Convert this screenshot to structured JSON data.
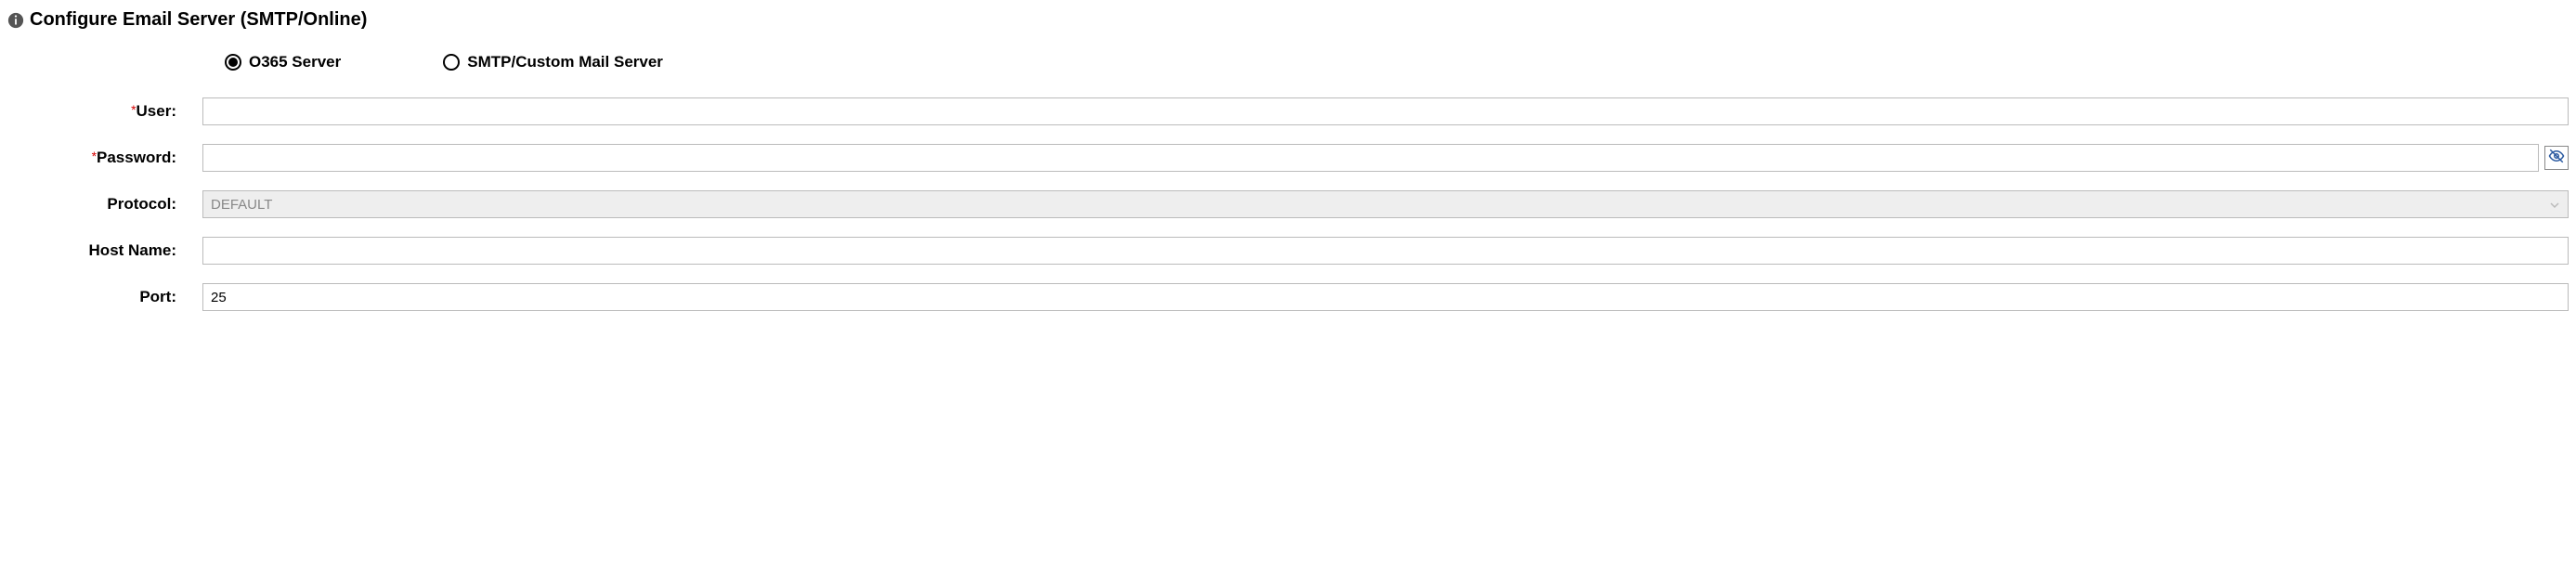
{
  "section": {
    "title": "Configure Email Server (SMTP/Online)"
  },
  "serverType": {
    "o365": "O365 Server",
    "smtp": "SMTP/Custom Mail Server"
  },
  "fields": {
    "user": {
      "label": "User:",
      "value": "",
      "required": true
    },
    "password": {
      "label": "Password:",
      "value": "",
      "required": true
    },
    "protocol": {
      "label": "Protocol:",
      "value": "DEFAULT"
    },
    "hostName": {
      "label": "Host Name:",
      "value": ""
    },
    "port": {
      "label": "Port:",
      "value": "25"
    }
  },
  "requiredMark": "*"
}
